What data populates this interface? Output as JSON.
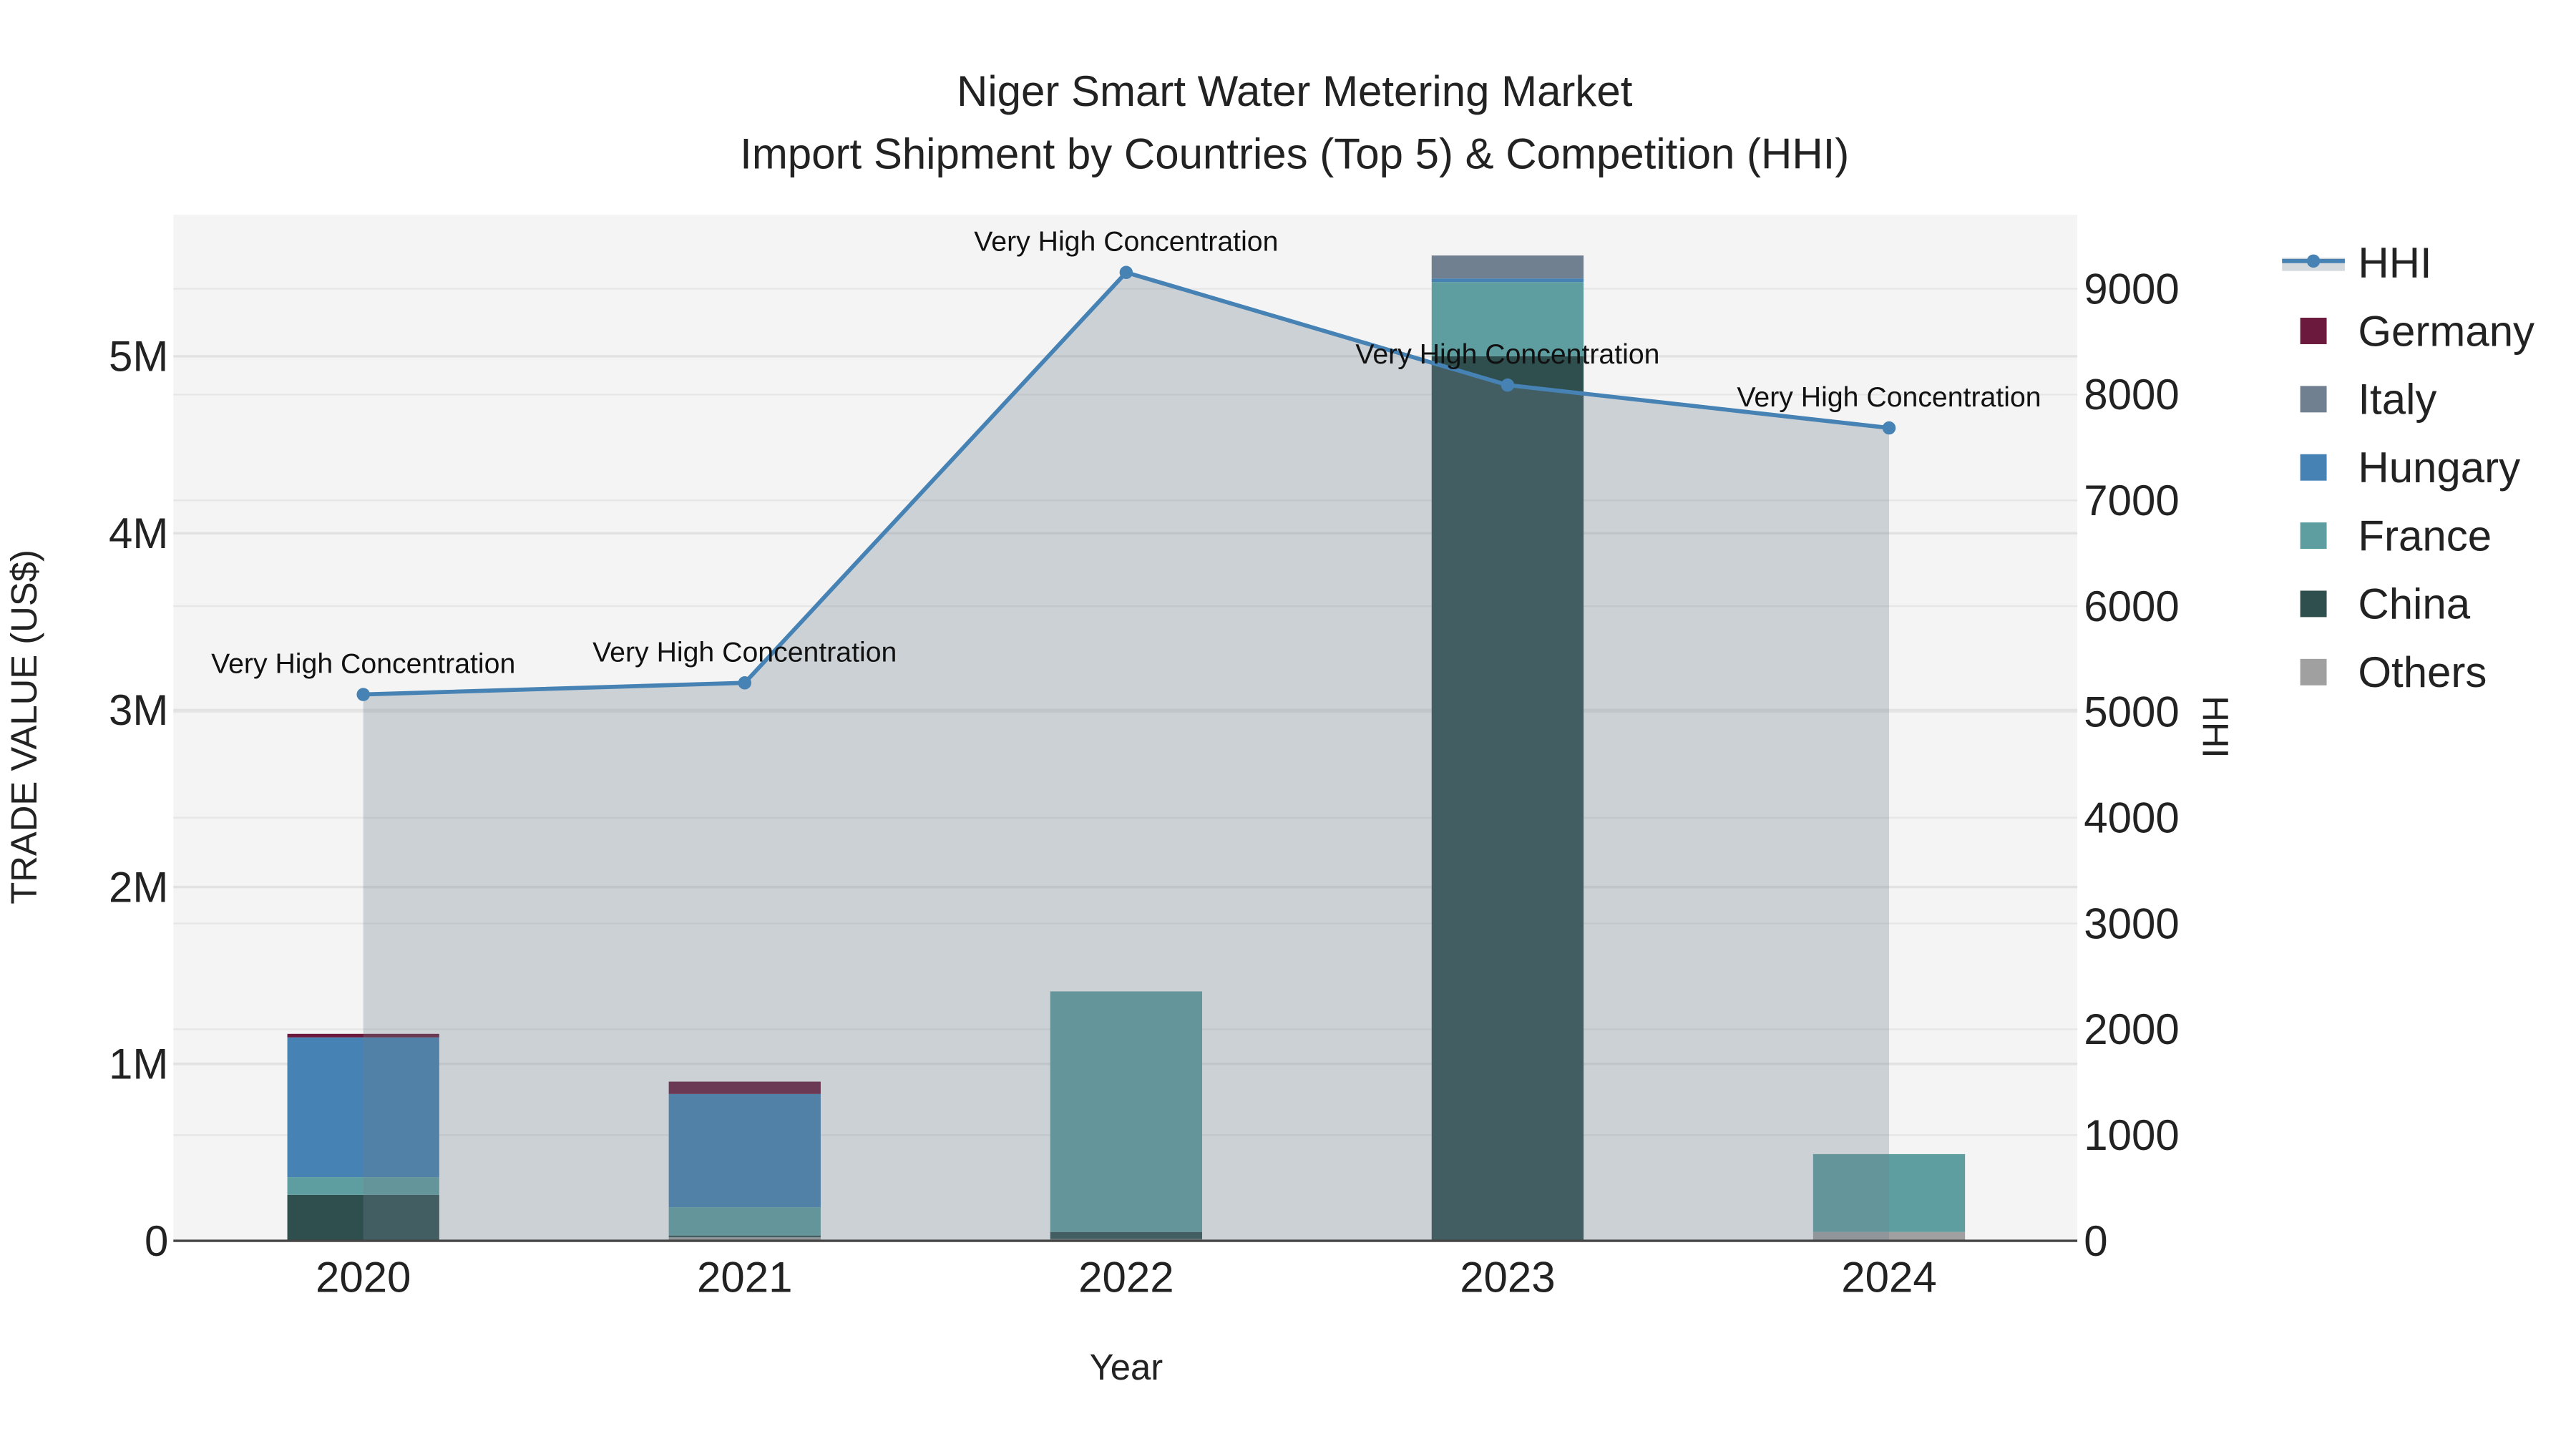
{
  "chart_data": {
    "type": "bar",
    "title": "Niger Smart Water Metering Market",
    "subtitle": "Import Shipment by Countries (Top 5) & Competition (HHI)",
    "xlabel": "Year",
    "ylabel": "TRADE VALUE (US$)",
    "y2label": "HHI",
    "categories": [
      "2020",
      "2021",
      "2022",
      "2023",
      "2024"
    ],
    "ylim": [
      0,
      5800000
    ],
    "y2lim": [
      0,
      9700
    ],
    "yticks": [
      {
        "v": 0,
        "label": "0"
      },
      {
        "v": 1000000,
        "label": "1M"
      },
      {
        "v": 2000000,
        "label": "2M"
      },
      {
        "v": 3000000,
        "label": "3M"
      },
      {
        "v": 4000000,
        "label": "4M"
      },
      {
        "v": 5000000,
        "label": "5M"
      }
    ],
    "y2ticks": [
      0,
      1000,
      2000,
      3000,
      4000,
      5000,
      6000,
      7000,
      8000,
      9000
    ],
    "series": [
      {
        "name": "Others",
        "color": "#a0a0a0",
        "values": [
          0,
          20000,
          10000,
          0,
          50000
        ]
      },
      {
        "name": "China",
        "color": "#2f4f4f",
        "values": [
          260000,
          10000,
          40000,
          5000000,
          0
        ]
      },
      {
        "name": "France",
        "color": "#5f9ea0",
        "values": [
          100000,
          160000,
          1360000,
          420000,
          440000
        ]
      },
      {
        "name": "Hungary",
        "color": "#4682b4",
        "values": [
          790000,
          640000,
          0,
          20000,
          0
        ]
      },
      {
        "name": "Italy",
        "color": "#708090",
        "values": [
          0,
          0,
          0,
          130000,
          0
        ]
      },
      {
        "name": "Germany",
        "color": "#6b1a3d",
        "values": [
          20000,
          70000,
          0,
          0,
          0
        ]
      }
    ],
    "hhi": {
      "name": "HHI",
      "color": "#4682b4",
      "values": [
        5165,
        5275,
        9155,
        8090,
        7685
      ],
      "annotations": [
        "Very High Concentration",
        "Very High Concentration",
        "Very High Concentration",
        "Very High Concentration",
        "Very High Concentration"
      ]
    },
    "legend": {
      "placement": "right",
      "order": [
        "HHI",
        "Germany",
        "Italy",
        "Hungary",
        "France",
        "China",
        "Others"
      ]
    },
    "grid": true
  }
}
